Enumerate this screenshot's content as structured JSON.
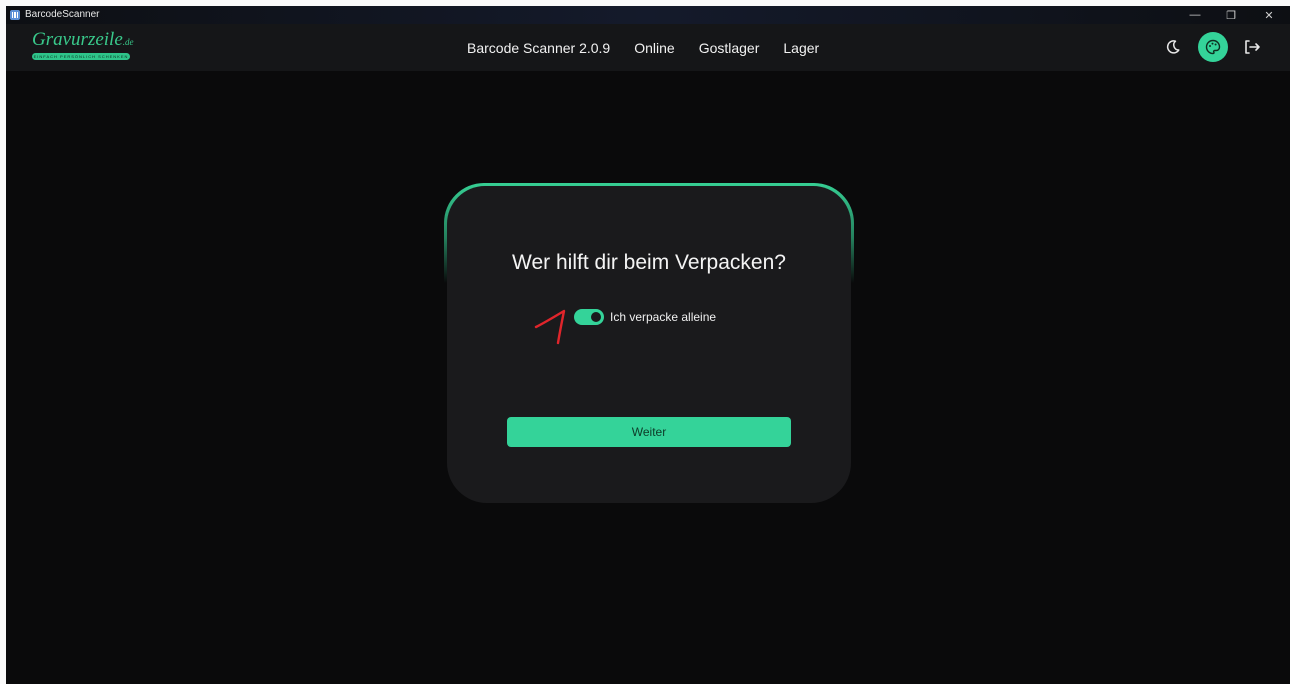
{
  "window": {
    "title": "BarcodeScanner",
    "controls": {
      "minimize": "—",
      "restore": "❐",
      "close": "✕"
    }
  },
  "navbar": {
    "logo": {
      "text_main": "Gravurzeile",
      "text_suffix": ".de",
      "tagline": "EINFACH PERSÖNLICH SCHENKEN"
    },
    "links": [
      {
        "label": "Barcode Scanner 2.0.9"
      },
      {
        "label": "Online"
      },
      {
        "label": "Gostlager"
      },
      {
        "label": "Lager"
      }
    ],
    "icons": [
      "moon-icon",
      "palette-icon",
      "logout-icon"
    ]
  },
  "dialog": {
    "title": "Wer hilft dir beim Verpacken?",
    "toggle": {
      "label": "Ich verpacke alleine",
      "checked": true
    },
    "button_label": "Weiter"
  },
  "colors": {
    "accent": "#34d399",
    "background": "#0a0a0b",
    "navbar": "#151618",
    "card": "#1a1a1c",
    "annotation": "#e0252b"
  }
}
